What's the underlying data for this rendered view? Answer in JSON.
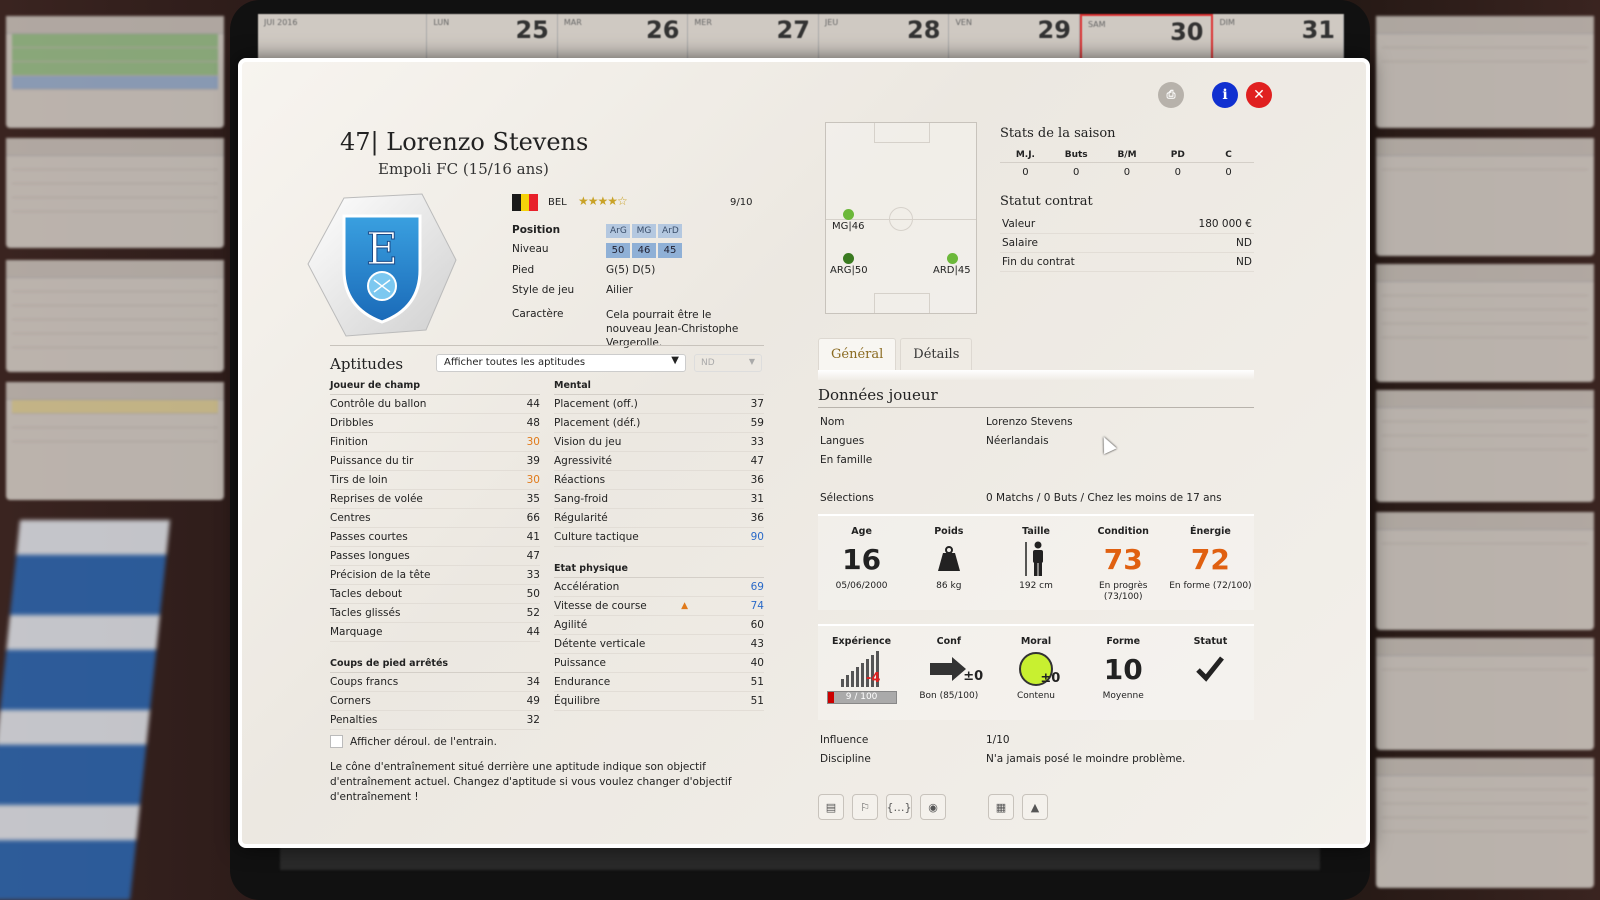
{
  "calendar": {
    "month": "JUI 2016",
    "days": [
      {
        "name": "LUN",
        "num": "25"
      },
      {
        "name": "MAR",
        "num": "26"
      },
      {
        "name": "MER",
        "num": "27"
      },
      {
        "name": "JEU",
        "num": "28"
      },
      {
        "name": "VEN",
        "num": "29"
      },
      {
        "name": "SAM",
        "num": "30"
      },
      {
        "name": "DIM",
        "num": "31"
      }
    ]
  },
  "player": {
    "number_name": "47| Lorenzo Stevens",
    "club": "Empoli FC (15/16 ans)",
    "nationality": "BEL",
    "stars": "★★★★☆",
    "rating": "9/10",
    "flag_colors": [
      "#1a1a1a",
      "#f5d20a",
      "#e8202a"
    ]
  },
  "info": {
    "position_label": "Position",
    "positions": [
      "ArG",
      "MG",
      "ArD"
    ],
    "level_label": "Niveau",
    "levels": [
      "50",
      "46",
      "45"
    ],
    "foot_label": "Pied",
    "foot": "G(5) D(5)",
    "style_label": "Style de jeu",
    "style": "Ailier",
    "character_label": "Caractère",
    "character": "Cela pourrait être le nouveau Jean-Christophe Vergerolle."
  },
  "aptitudes": {
    "title": "Aptitudes",
    "filter": "Afficher toutes les aptitudes",
    "nd": "ND",
    "field_head": "Joueur de champ",
    "field": [
      {
        "n": "Contrôle du ballon",
        "v": "44",
        "c": ""
      },
      {
        "n": "Dribbles",
        "v": "48",
        "c": ""
      },
      {
        "n": "Finition",
        "v": "30",
        "c": "low"
      },
      {
        "n": "Puissance du tir",
        "v": "39",
        "c": ""
      },
      {
        "n": "Tirs de loin",
        "v": "30",
        "c": "low"
      },
      {
        "n": "Reprises de volée",
        "v": "35",
        "c": ""
      },
      {
        "n": "Centres",
        "v": "66",
        "c": ""
      },
      {
        "n": "Passes courtes",
        "v": "41",
        "c": ""
      },
      {
        "n": "Passes longues",
        "v": "47",
        "c": ""
      },
      {
        "n": "Précision de la tête",
        "v": "33",
        "c": ""
      },
      {
        "n": "Tacles debout",
        "v": "50",
        "c": ""
      },
      {
        "n": "Tacles glissés",
        "v": "52",
        "c": ""
      },
      {
        "n": "Marquage",
        "v": "44",
        "c": ""
      }
    ],
    "setpiece_head": "Coups de pied arrêtés",
    "setpiece": [
      {
        "n": "Coups francs",
        "v": "34",
        "c": ""
      },
      {
        "n": "Corners",
        "v": "49",
        "c": ""
      },
      {
        "n": "Penalties",
        "v": "32",
        "c": ""
      }
    ],
    "mental_head": "Mental",
    "mental": [
      {
        "n": "Placement (off.)",
        "v": "37",
        "c": ""
      },
      {
        "n": "Placement (déf.)",
        "v": "59",
        "c": ""
      },
      {
        "n": "Vision du jeu",
        "v": "33",
        "c": ""
      },
      {
        "n": "Agressivité",
        "v": "47",
        "c": ""
      },
      {
        "n": "Réactions",
        "v": "36",
        "c": ""
      },
      {
        "n": "Sang-froid",
        "v": "31",
        "c": ""
      },
      {
        "n": "Régularité",
        "v": "36",
        "c": ""
      },
      {
        "n": "Culture tactique",
        "v": "90",
        "c": "hi"
      }
    ],
    "physical_head": "Etat physique",
    "physical": [
      {
        "n": "Accélération",
        "v": "69",
        "c": "hi"
      },
      {
        "n": "Vitesse de course",
        "v": "74",
        "c": "hi"
      },
      {
        "n": "Agilité",
        "v": "60",
        "c": ""
      },
      {
        "n": "Détente verticale",
        "v": "43",
        "c": ""
      },
      {
        "n": "Puissance",
        "v": "40",
        "c": ""
      },
      {
        "n": "Endurance",
        "v": "51",
        "c": ""
      },
      {
        "n": "Équilibre",
        "v": "51",
        "c": ""
      }
    ],
    "checkbox_label": "Afficher déroul. de l'entrain.",
    "hint": "Le cône d'entraînement situé derrière une aptitude indique son objectif d'entraînement actuel. Changez d'aptitude si vous voulez changer d'objectif d'entraînement !"
  },
  "pitch": {
    "mg": "MG|46",
    "arg": "ARG|50",
    "ard": "ARD|45"
  },
  "season": {
    "title": "Stats de la saison",
    "headers": [
      "M.J.",
      "Buts",
      "B/M",
      "PD",
      "C"
    ],
    "values": [
      "0",
      "0",
      "0",
      "0",
      "0"
    ]
  },
  "contract": {
    "title": "Statut contrat",
    "value_label": "Valeur",
    "value": "180 000 €",
    "salary_label": "Salaire",
    "salary": "ND",
    "end_label": "Fin du contrat",
    "end": "ND"
  },
  "tabs": {
    "general": "Général",
    "details": "Détails"
  },
  "donnees": {
    "title": "Données joueur",
    "nom_label": "Nom",
    "nom": "Lorenzo Stevens",
    "langues_label": "Langues",
    "langues": "Néerlandais",
    "famille_label": "En famille",
    "famille": "",
    "selections_label": "Sélections",
    "selections": "0 Matchs / 0 Buts / Chez les moins de 17 ans"
  },
  "stats1": {
    "age_t": "Age",
    "age": "16",
    "age_sub": "05/06/2000",
    "poids_t": "Poids",
    "poids_sub": "86 kg",
    "taille_t": "Taille",
    "taille_sub": "192 cm",
    "cond_t": "Condition",
    "cond": "73",
    "cond_sub": "En progrès (73/100)",
    "energie_t": "Énergie",
    "energie": "72",
    "energie_sub": "En forme (72/100)"
  },
  "stats2": {
    "exp_t": "Expérience",
    "exp_delta": "-4",
    "exp_bar": "9 / 100",
    "exp_fraction": 0.09,
    "conf_t": "Conf",
    "conf_delta": "±0",
    "conf_sub": "Bon (85/100)",
    "moral_t": "Moral",
    "moral_delta": "±0",
    "moral_sub": "Contenu",
    "forme_t": "Forme",
    "forme": "10",
    "forme_sub": "Moyenne",
    "statut_t": "Statut"
  },
  "bottom": {
    "influence_label": "Influence",
    "influence": "1/10",
    "discipline_label": "Discipline",
    "discipline": "N'a jamais posé le moindre problème."
  },
  "colors": {
    "accent_orange": "#e06010",
    "low_value": "#e07a1a",
    "high_value": "#2a6ac8",
    "close_red": "#e02020",
    "info_blue": "#1030d0"
  }
}
